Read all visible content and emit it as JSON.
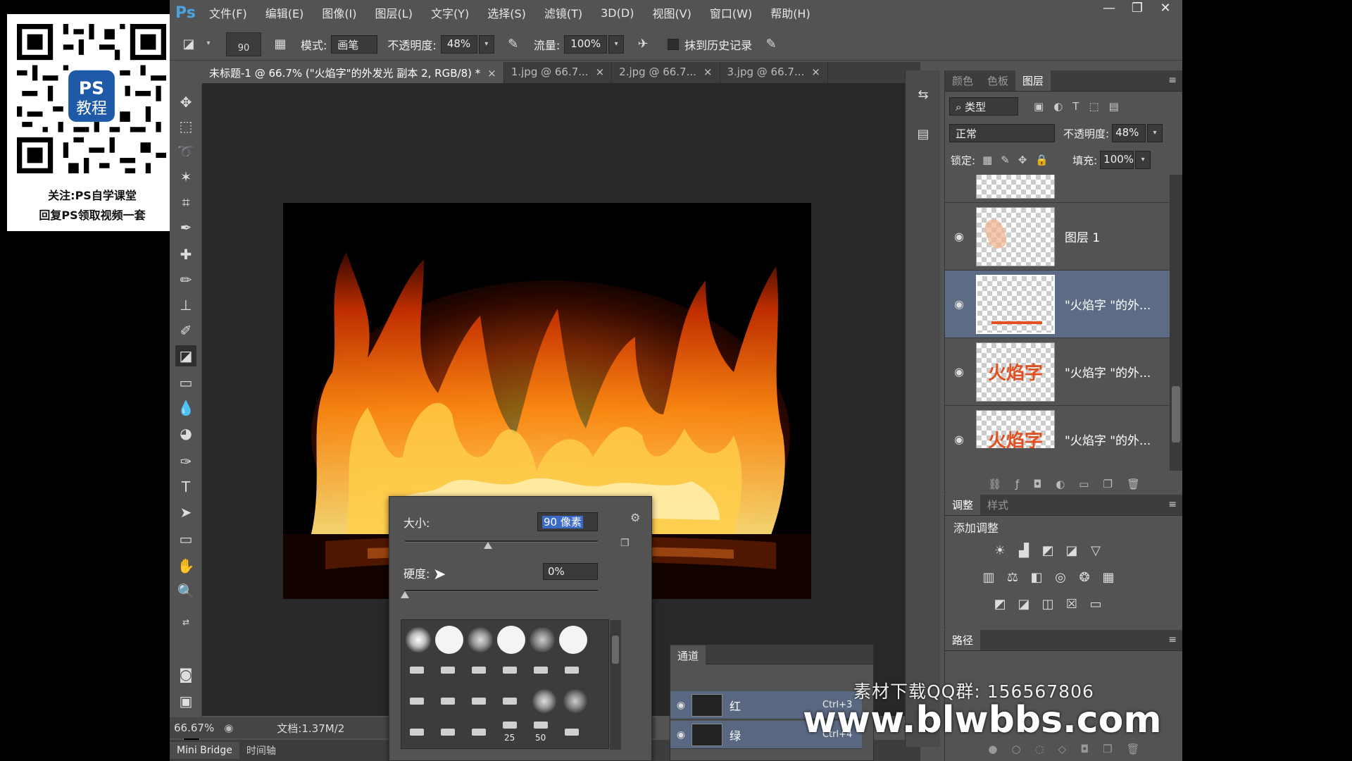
{
  "qr": {
    "badge_line1": "PS",
    "badge_line2": "教程",
    "caption_line1": "关注:PS自学课堂",
    "caption_line2": "回复PS领取视频一套"
  },
  "app": {
    "logo": "Ps",
    "menu": [
      "文件(F)",
      "编辑(E)",
      "图像(I)",
      "图层(L)",
      "文字(Y)",
      "选择(S)",
      "滤镜(T)",
      "3D(D)",
      "视图(V)",
      "窗口(W)",
      "帮助(H)"
    ],
    "window_controls": {
      "minimize": "—",
      "restore": "❐",
      "close": "✕"
    }
  },
  "options": {
    "brush_size": "90",
    "mode_label": "模式:",
    "mode_value": "画笔",
    "opacity_label": "不透明度:",
    "opacity_value": "48%",
    "flow_label": "流量:",
    "flow_value": "100%",
    "erase_history_label": "抹到历史记录"
  },
  "tabs": [
    {
      "label": "未标题-1 @ 66.7% (\"火焰字\"的外发光 副本 2, RGB/8) *",
      "active": true
    },
    {
      "label": "1.jpg @ 66.7...",
      "active": false
    },
    {
      "label": "2.jpg @ 66.7...",
      "active": false
    },
    {
      "label": "3.jpg @ 66.7...",
      "active": false
    }
  ],
  "tab_close_glyph": "×",
  "status": {
    "zoom": "66.67%",
    "doc": "文档:1.37M/2"
  },
  "bottom_tabs": [
    "Mini Bridge",
    "时间轴"
  ],
  "brush_popup": {
    "size_label": "大小:",
    "size_value": "90 像素",
    "size_slider": 0.43,
    "hardness_label": "硬度:",
    "hardness_value": "0%",
    "hardness_slider": 0.0,
    "preset_num_1": "25",
    "preset_num_2": "50"
  },
  "channels": {
    "tab": "通道",
    "rows": [
      {
        "name": "红",
        "shortcut": "Ctrl+3"
      },
      {
        "name": "绿",
        "shortcut": "Ctrl+4"
      }
    ]
  },
  "layers_panel": {
    "tabs": [
      "颜色",
      "色板",
      "图层"
    ],
    "filter_label": "类型",
    "blend_mode": "正常",
    "opacity_label": "不透明度:",
    "opacity_value": "48%",
    "lock_label": "锁定:",
    "fill_label": "填充:",
    "fill_value": "100%",
    "layers": [
      {
        "name": "图层 1",
        "selected": false,
        "thumb": ""
      },
      {
        "name": "\"火焰字 \"的外...",
        "selected": true,
        "thumb": ""
      },
      {
        "name": "\"火焰字 \"的外...",
        "selected": false,
        "thumb": "火焰字"
      },
      {
        "name": "\"火焰字 \"的外...",
        "selected": false,
        "thumb": "火焰字"
      }
    ]
  },
  "adjust_panel": {
    "tabs": [
      "调整",
      "样式"
    ],
    "heading": "添加调整"
  },
  "paths_panel": {
    "tab": "路径"
  },
  "watermark": {
    "qq": "素材下载QQ群: 156567806",
    "url": "www.blwbbs.com"
  },
  "colors": {
    "foreground": "#e01010",
    "background": "#000000",
    "selection": "#5d6b84"
  }
}
